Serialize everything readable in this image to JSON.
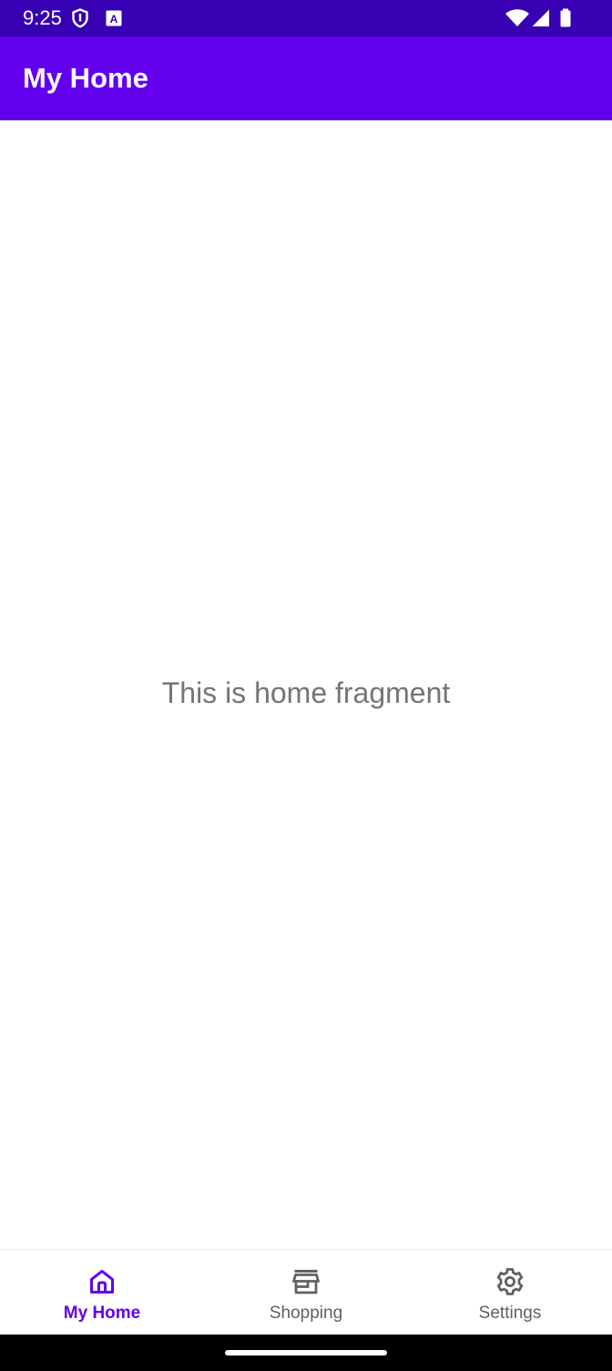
{
  "status_bar": {
    "time": "9:25",
    "color": "#3700b3",
    "left_icons": [
      "shield-icon",
      "a-box-icon"
    ],
    "right_icons": [
      "wifi-icon",
      "signal-icon",
      "battery-icon"
    ]
  },
  "app_bar": {
    "title": "My Home",
    "color": "#6200ee"
  },
  "content": {
    "message": "This is home fragment"
  },
  "bottom_nav": {
    "active_color": "#6200ee",
    "items": [
      {
        "label": "My Home",
        "icon": "home-icon",
        "active": true
      },
      {
        "label": "Shopping",
        "icon": "store-icon",
        "active": false
      },
      {
        "label": "Settings",
        "icon": "gear-icon",
        "active": false
      }
    ]
  }
}
